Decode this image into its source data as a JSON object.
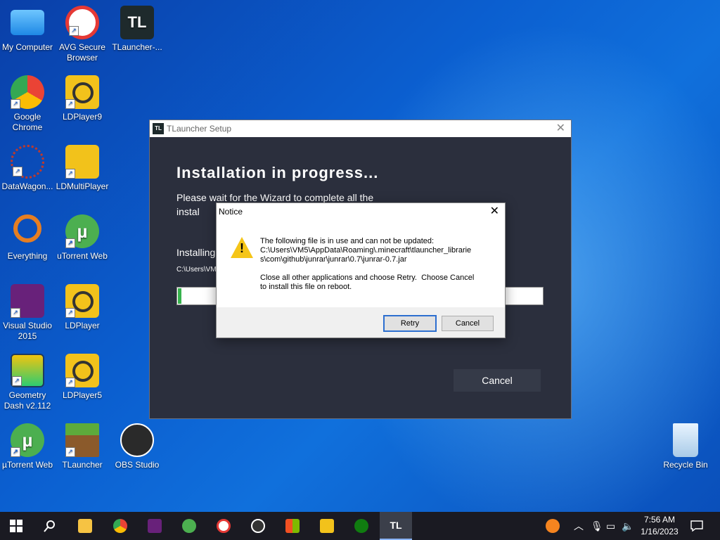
{
  "desktop": {
    "icons": [
      {
        "label": "My Computer"
      },
      {
        "label": "AVG Secure Browser"
      },
      {
        "label": "TLauncher-..."
      },
      {
        "label": "Google Chrome"
      },
      {
        "label": "LDPlayer9"
      },
      {
        "label": "DataWagon..."
      },
      {
        "label": "LDMultiPlayer"
      },
      {
        "label": "Everything"
      },
      {
        "label": "uTorrent Web"
      },
      {
        "label": "Visual Studio 2015"
      },
      {
        "label": "LDPlayer"
      },
      {
        "label": "Geometry Dash v2.112"
      },
      {
        "label": "LDPlayer5"
      },
      {
        "label": "µTorrent Web"
      },
      {
        "label": "TLauncher"
      },
      {
        "label": "OBS Studio"
      },
      {
        "label": "Recycle Bin"
      }
    ]
  },
  "setup": {
    "title": "TLauncher Setup",
    "logo": "TL",
    "close": "✕",
    "heading": "Installation in progress...",
    "desc": "Please wait for the Wizard to complete all the instal",
    "status": "Installing",
    "path": "C:\\Users\\VM",
    "progress": 0.01,
    "cancel_label": "Cancel"
  },
  "notice": {
    "title": "Notice",
    "close": "✕",
    "line1": "The following file is in use and can not be updated:",
    "line2": "C:\\Users\\VM5\\AppData\\Roaming\\.minecraft\\tlauncher_librarie",
    "line3": "s\\com\\github\\junrar\\junrar\\0.7\\junrar-0.7.jar",
    "line4": "Close all other applications and choose Retry.  Choose Cancel",
    "line5": "to install this file on reboot.",
    "retry_label": "Retry",
    "cancel_label": "Cancel"
  },
  "taskbar": {
    "time": "7:56 AM",
    "date": "1/16/2023",
    "tl_label": "TL"
  }
}
